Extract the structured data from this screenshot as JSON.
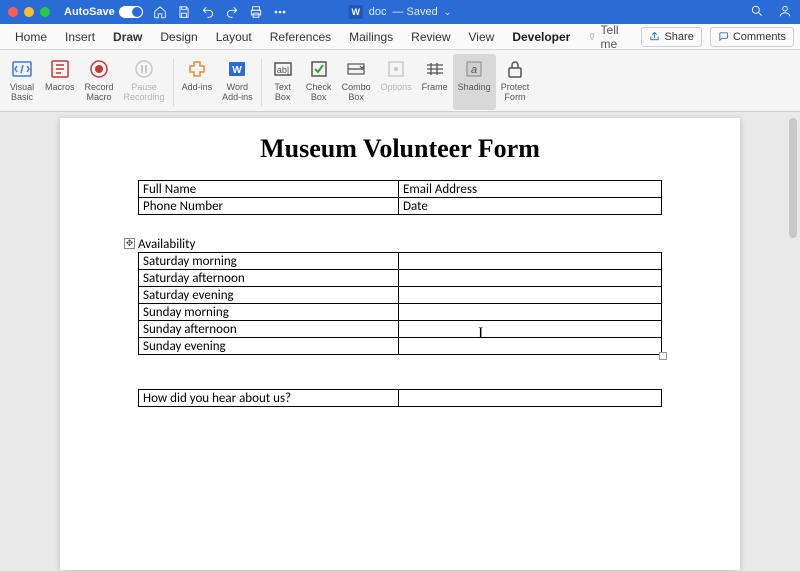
{
  "titlebar": {
    "autosave_label": "AutoSave",
    "autosave_state": "ON",
    "doc_prefix": "doc",
    "doc_status": "— Saved"
  },
  "tabs": {
    "home": "Home",
    "insert": "Insert",
    "draw": "Draw",
    "design": "Design",
    "layout": "Layout",
    "references": "References",
    "mailings": "Mailings",
    "review": "Review",
    "view": "View",
    "developer": "Developer",
    "tellme": "Tell me",
    "share": "Share",
    "comments": "Comments"
  },
  "ribbon": {
    "visual_basic": "Visual\nBasic",
    "macros": "Macros",
    "record_macro": "Record\nMacro",
    "pause_recording": "Pause\nRecording",
    "add_ins": "Add-ins",
    "word_add_ins": "Word\nAdd-ins",
    "text_box": "Text\nBox",
    "check_box": "Check\nBox",
    "combo_box": "Combo\nBox",
    "options": "Options",
    "frame": "Frame",
    "shading": "Shading",
    "protect_form": "Protect\nForm"
  },
  "document": {
    "title": "Museum Volunteer Form",
    "contact": {
      "full_name_label": "Full Name",
      "email_label": "Email Address",
      "phone_label": "Phone Number",
      "date_label": "Date"
    },
    "availability_header": "Availability",
    "availability": [
      "Saturday morning",
      "Saturday afternoon",
      "Saturday evening",
      "Sunday morning",
      "Sunday afternoon",
      "Sunday evening"
    ],
    "hear_about": "How did you hear about us?"
  }
}
